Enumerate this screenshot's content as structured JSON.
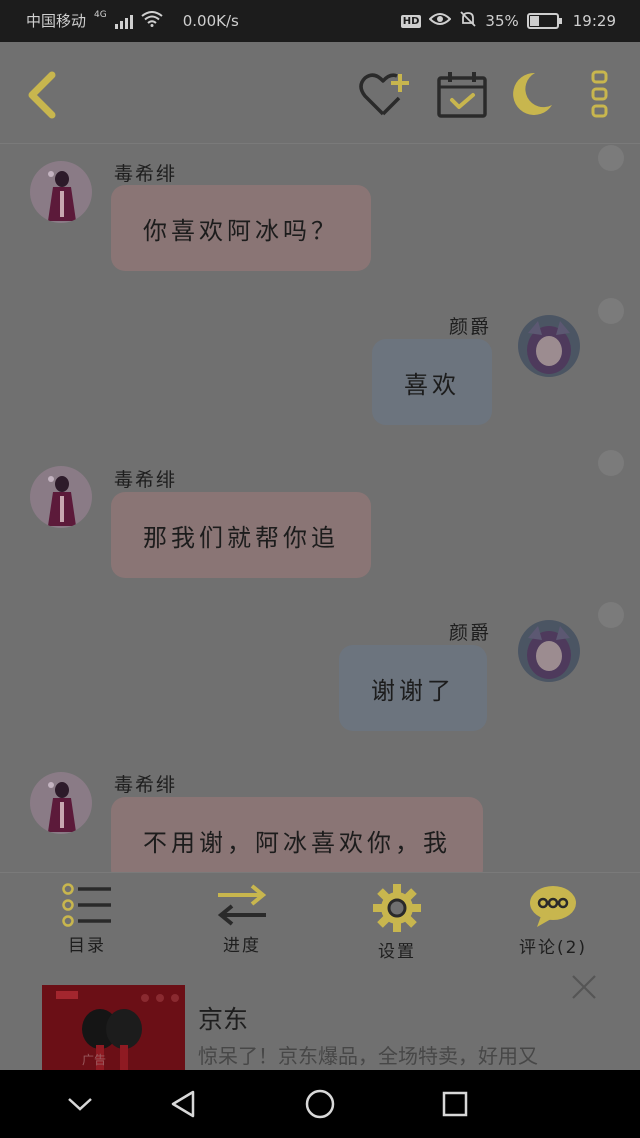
{
  "status_bar": {
    "carrier": "中国移动",
    "network": "4G",
    "speed": "0.00K/s",
    "hd": "HD",
    "battery": "35%",
    "battery_level": 0.35,
    "time": "19:29"
  },
  "top_bar": {
    "icons": [
      "back-icon",
      "favorite-add-icon",
      "calendar-check-icon",
      "night-mode-icon",
      "more-icon"
    ],
    "accent_color": "#c8b64e"
  },
  "messages": [
    {
      "side": "left",
      "sender": "毒希绯",
      "text": "你喜欢阿冰吗？"
    },
    {
      "side": "right",
      "sender": "颜爵",
      "text": "喜欢"
    },
    {
      "side": "left",
      "sender": "毒希绯",
      "text": "那我们就帮你追"
    },
    {
      "side": "right",
      "sender": "颜爵",
      "text": "谢谢了"
    },
    {
      "side": "left",
      "sender": "毒希绯",
      "text": "不用谢，阿冰喜欢你，我"
    }
  ],
  "toolbar": {
    "catalog": "目录",
    "progress": "进度",
    "settings": "设置",
    "comments": "评论(2)"
  },
  "ad": {
    "brand": "京东",
    "description": "惊呆了！京东爆品，全场特卖，好用又",
    "ad_label": "广告"
  },
  "colors": {
    "overlay": "#707070",
    "left_bubble": "#8a7575",
    "right_bubble": "#6c747e",
    "nav_bar": "#000000"
  }
}
